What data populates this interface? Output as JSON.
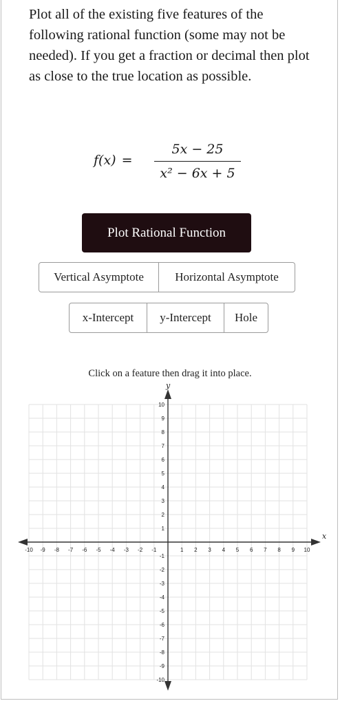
{
  "prompt": "Plot all of the existing five features of the following rational function (some may not be needed). If you get a fraction or decimal then plot as close to the true location as possible.",
  "formula": {
    "lhs": "f(x)",
    "equals": "=",
    "numerator": "5x − 25",
    "denominator": "x² − 6x + 5"
  },
  "plot_button": {
    "label": "Plot Rational Function"
  },
  "feature_buttons": {
    "vertical_asymptote": "Vertical Asymptote",
    "horizontal_asymptote": "Horizontal Asymptote",
    "x_intercept": "x-Intercept",
    "y_intercept": "y-Intercept",
    "hole": "Hole"
  },
  "instruction": "Click on a feature then drag it into place.",
  "graph": {
    "x_axis_label": "x",
    "y_axis_label": "y",
    "x_min": -10,
    "x_max": 10,
    "y_min": -10,
    "y_max": 10,
    "x_ticks": [
      "-10",
      "-9",
      "-8",
      "-7",
      "-6",
      "-5",
      "-4",
      "-3",
      "-2",
      "-1",
      "1",
      "2",
      "3",
      "4",
      "5",
      "6",
      "7",
      "8",
      "9",
      "10"
    ],
    "y_ticks": [
      "10",
      "9",
      "8",
      "7",
      "6",
      "5",
      "4",
      "3",
      "2",
      "1",
      "-1",
      "-2",
      "-3",
      "-4",
      "-5",
      "-6",
      "-7",
      "-8",
      "-9",
      "-10"
    ],
    "grid": true,
    "grid_color": "#e2e2e2",
    "axis_color": "#333333"
  }
}
